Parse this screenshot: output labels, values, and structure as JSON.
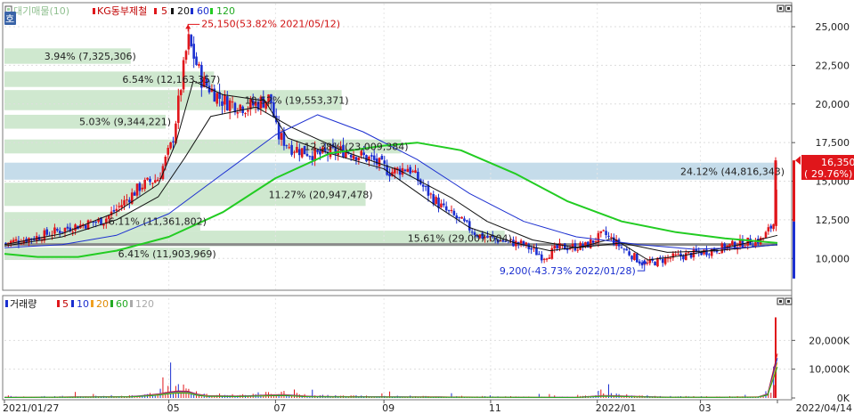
{
  "price_legend": {
    "prefix": "대기매물(10)",
    "stock": "KG동부제철",
    "ma5": "5",
    "ma20": "20",
    "ma60": "60",
    "ma120": "120"
  },
  "volume_legend": {
    "prefix": "거래량",
    "ma5": "5",
    "ma10": "10",
    "ma20": "20",
    "ma60": "60",
    "ma120": "120"
  },
  "side_badge": "호",
  "annotations": {
    "high": "25,150(53.82% 2021/05/12)",
    "low": "9,200(-43.73% 2022/01/28)"
  },
  "current_price": "16,350",
  "current_change": "29.76%",
  "colors": {
    "profile_green": "#cfe8cf",
    "profile_blue": "#c5dcea",
    "up": "#e0161b",
    "down": "#1b2fd0",
    "ma5": "#111111",
    "ma20": "#1c2fd0",
    "ma60": "#22cc22",
    "ma120": "#a6a6a6"
  },
  "chart_data": [
    {
      "type": "candlestick",
      "title": "KG동부제철",
      "ylim": [
        8000,
        26500
      ],
      "y_ticks": [
        "25,000",
        "22,500",
        "20,000",
        "17,500",
        "15,000",
        "12,500",
        "10,000"
      ],
      "x_ticks": [
        "2021/01/27",
        "05",
        "07",
        "09",
        "11",
        "2022/01",
        "03",
        "2022/04/14"
      ],
      "price_profile": [
        {
          "label": "3.94% (7,325,306)",
          "low": 22600,
          "high": 23600,
          "pct": 3.94
        },
        {
          "label": "6.54% (12,163,357)",
          "low": 21100,
          "high": 22100,
          "pct": 6.54
        },
        {
          "label": "10.52% (19,553,371)",
          "low": 19600,
          "high": 20900,
          "pct": 10.52
        },
        {
          "label": "5.03% (9,344,221)",
          "low": 18400,
          "high": 19300,
          "pct": 5.03
        },
        {
          "label": "12.38% (23,009,384)",
          "low": 16800,
          "high": 17700,
          "pct": 12.38
        },
        {
          "label": "24.12% (44,816,343)",
          "low": 15100,
          "high": 16200,
          "pct": 24.12
        },
        {
          "label": "11.27% (20,947,478)",
          "low": 13400,
          "high": 14900,
          "pct": 11.27
        },
        {
          "label": "6.11% (11,361,802)",
          "low": 11800,
          "high": 13000,
          "pct": 6.11
        },
        {
          "label": "15.61% (29,007,004)",
          "low": 10800,
          "high": 11800,
          "pct": 15.61
        },
        {
          "label": "6.41% (11,903,969)",
          "low": 9900,
          "high": 10700,
          "pct": 6.41
        }
      ],
      "highlight_level": 10900,
      "high_point": {
        "date": "2021/05/12",
        "price": 25150,
        "change_pct": 53.82
      },
      "low_point": {
        "date": "2022/01/28",
        "price": 9200,
        "change_pct": -43.73
      },
      "last_price": 16350,
      "last_change_pct": 29.76,
      "price_anchors": [
        [
          "2021/01/27",
          11000
        ],
        [
          "2021/02/15",
          11400
        ],
        [
          "2021/03/05",
          12000
        ],
        [
          "2021/03/25",
          12500
        ],
        [
          "2021/04/05",
          13600
        ],
        [
          "2021/04/15",
          14700
        ],
        [
          "2021/04/25",
          15200
        ],
        [
          "2021/05/03",
          17500
        ],
        [
          "2021/05/12",
          24200
        ],
        [
          "2021/05/20",
          21500
        ],
        [
          "2021/06/01",
          20200
        ],
        [
          "2021/06/15",
          19800
        ],
        [
          "2021/06/28",
          20400
        ],
        [
          "2021/07/02",
          18000
        ],
        [
          "2021/07/10",
          17200
        ],
        [
          "2021/07/25",
          16700
        ],
        [
          "2021/08/10",
          17000
        ],
        [
          "2021/08/25",
          16400
        ],
        [
          "2021/09/05",
          15600
        ],
        [
          "2021/09/15",
          15900
        ],
        [
          "2021/09/25",
          14400
        ],
        [
          "2021/10/05",
          13200
        ],
        [
          "2021/10/15",
          12400
        ],
        [
          "2021/10/25",
          11500
        ],
        [
          "2021/11/05",
          11200
        ],
        [
          "2021/11/20",
          10900
        ],
        [
          "2021/12/01",
          10100
        ],
        [
          "2021/12/10",
          10700
        ],
        [
          "2021/12/25",
          10800
        ],
        [
          "2022/01/05",
          11600
        ],
        [
          "2022/01/15",
          10700
        ],
        [
          "2022/01/28",
          9600
        ],
        [
          "2022/02/10",
          10000
        ],
        [
          "2022/02/25",
          10300
        ],
        [
          "2022/03/10",
          10600
        ],
        [
          "2022/03/25",
          11000
        ],
        [
          "2022/04/05",
          11200
        ],
        [
          "2022/04/12",
          12300
        ],
        [
          "2022/04/14",
          16350
        ]
      ],
      "ma_anchors": {
        "ma5": [
          [
            "2021/01/27",
            10900
          ],
          [
            "2021/03/01",
            11600
          ],
          [
            "2021/04/01",
            13000
          ],
          [
            "2021/04/25",
            14800
          ],
          [
            "2021/05/05",
            17500
          ],
          [
            "2021/05/15",
            21500
          ],
          [
            "2021/06/01",
            20600
          ],
          [
            "2021/06/25",
            20200
          ],
          [
            "2021/07/08",
            17800
          ],
          [
            "2021/08/01",
            16800
          ],
          [
            "2021/09/01",
            15800
          ],
          [
            "2021/10/01",
            13400
          ],
          [
            "2021/10/20",
            12000
          ],
          [
            "2021/11/15",
            11000
          ],
          [
            "2021/12/05",
            10500
          ],
          [
            "2021/12/25",
            10800
          ],
          [
            "2022/01/10",
            11300
          ],
          [
            "2022/01/30",
            9900
          ],
          [
            "2022/02/20",
            10200
          ],
          [
            "2022/03/20",
            10800
          ],
          [
            "2022/04/14",
            11500
          ]
        ],
        "ma20": [
          [
            "2021/01/27",
            10800
          ],
          [
            "2021/03/01",
            11400
          ],
          [
            "2021/04/01",
            12500
          ],
          [
            "2021/04/25",
            14000
          ],
          [
            "2021/05/10",
            16500
          ],
          [
            "2021/05/25",
            19200
          ],
          [
            "2021/06/20",
            19800
          ],
          [
            "2021/07/10",
            18500
          ],
          [
            "2021/08/10",
            16900
          ],
          [
            "2021/09/10",
            15700
          ],
          [
            "2021/10/10",
            13900
          ],
          [
            "2021/10/30",
            12400
          ],
          [
            "2021/11/25",
            11200
          ],
          [
            "2021/12/20",
            10700
          ],
          [
            "2022/01/15",
            11000
          ],
          [
            "2022/02/10",
            10400
          ],
          [
            "2022/03/10",
            10500
          ],
          [
            "2022/04/14",
            10900
          ]
        ],
        "ma60": [
          [
            "2021/01/27",
            10700
          ],
          [
            "2021/03/01",
            10900
          ],
          [
            "2021/04/01",
            11500
          ],
          [
            "2021/05/01",
            12900
          ],
          [
            "2021/06/01",
            15500
          ],
          [
            "2021/07/01",
            18000
          ],
          [
            "2021/07/25",
            19300
          ],
          [
            "2021/08/20",
            18200
          ],
          [
            "2021/09/20",
            16400
          ],
          [
            "2021/10/20",
            14200
          ],
          [
            "2021/11/20",
            12400
          ],
          [
            "2021/12/20",
            11400
          ],
          [
            "2022/01/25",
            10900
          ],
          [
            "2022/02/25",
            10600
          ],
          [
            "2022/03/25",
            10700
          ],
          [
            "2022/04/14",
            10900
          ]
        ],
        "ma120": [
          [
            "2021/01/27",
            10300
          ],
          [
            "2021/02/15",
            10100
          ],
          [
            "2021/03/10",
            10100
          ],
          [
            "2021/04/01",
            10500
          ],
          [
            "2021/05/01",
            11400
          ],
          [
            "2021/06/01",
            13000
          ],
          [
            "2021/07/01",
            15200
          ],
          [
            "2021/08/01",
            16800
          ],
          [
            "2021/09/01",
            17300
          ],
          [
            "2021/09/20",
            17500
          ],
          [
            "2021/10/15",
            17000
          ],
          [
            "2021/11/15",
            15500
          ],
          [
            "2021/12/15",
            13700
          ],
          [
            "2022/01/15",
            12400
          ],
          [
            "2022/02/15",
            11700
          ],
          [
            "2022/03/15",
            11300
          ],
          [
            "2022/04/14",
            11000
          ]
        ]
      }
    },
    {
      "type": "bar",
      "title": "거래량",
      "ylim": [
        0,
        30000
      ],
      "y_ticks": [
        "20,000K",
        "10,000K",
        "0K"
      ],
      "volume_anchors": [
        [
          "2021/01/27",
          400
        ],
        [
          "2021/04/10",
          900
        ],
        [
          "2021/04/25",
          2500
        ],
        [
          "2021/05/05",
          4500
        ],
        [
          "2021/05/12",
          4200
        ],
        [
          "2021/05/20",
          1500
        ],
        [
          "2021/06/10",
          1200
        ],
        [
          "2021/07/05",
          2200
        ],
        [
          "2021/07/20",
          1000
        ],
        [
          "2021/08/20",
          800
        ],
        [
          "2021/09/20",
          700
        ],
        [
          "2021/10/20",
          600
        ],
        [
          "2021/11/20",
          500
        ],
        [
          "2021/12/20",
          400
        ],
        [
          "2022/01/05",
          1600
        ],
        [
          "2022/02/05",
          600
        ],
        [
          "2022/03/10",
          500
        ],
        [
          "2022/04/05",
          700
        ],
        [
          "2022/04/12",
          4500
        ],
        [
          "2022/04/14",
          28000
        ]
      ]
    }
  ]
}
